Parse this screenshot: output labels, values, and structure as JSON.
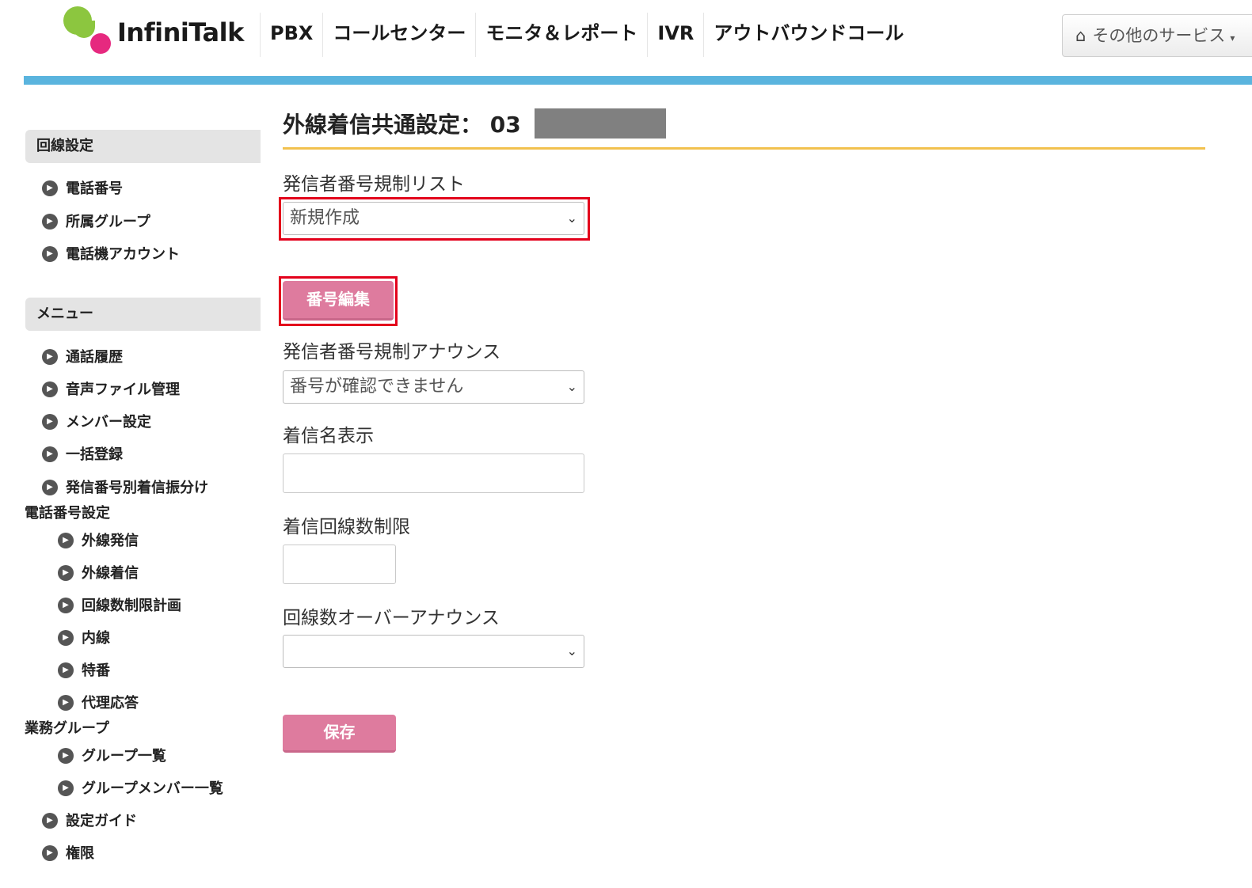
{
  "brand": {
    "name": "InfiniTalk",
    "colors": {
      "green": "#8cc63f",
      "pink": "#e6297f",
      "accent_bar": "#5ab4de",
      "button": "#de7b9e",
      "highlight": "#e3001b"
    }
  },
  "nav": {
    "items": [
      "PBX",
      "コールセンター",
      "モニタ＆レポート",
      "IVR",
      "アウトバウンドコール"
    ],
    "other_services": {
      "icon": "home-icon",
      "label": "その他のサービス"
    }
  },
  "sidebar": {
    "line_settings": {
      "heading": "回線設定",
      "items": [
        "電話番号",
        "所属グループ",
        "電話機アカウント"
      ]
    },
    "menu": {
      "heading": "メニュー",
      "items": [
        "通話履歴",
        "音声ファイル管理",
        "メンバー設定",
        "一括登録",
        "発信番号別着信振分け"
      ],
      "phone_settings": {
        "label": "電話番号設定",
        "items": [
          "外線発信",
          "外線着信",
          "回線数制限計画",
          "内線",
          "特番",
          "代理応答"
        ]
      },
      "business_group": {
        "label": "業務グループ",
        "items": [
          "グループ一覧",
          "グループメンバー一覧"
        ]
      },
      "bottom_items": [
        "設定ガイド",
        "権限"
      ]
    }
  },
  "main": {
    "title": "外線着信共通設定：",
    "title_number": "03",
    "fields": {
      "caller_restriction_list": {
        "label": "発信者番号規制リスト",
        "value": "新規作成"
      },
      "edit_number_button": "番号編集",
      "caller_restriction_announce": {
        "label": "発信者番号規制アナウンス",
        "value": "番号が確認できません"
      },
      "incoming_name_display": {
        "label": "着信名表示",
        "value": ""
      },
      "incoming_line_limit": {
        "label": "着信回線数制限",
        "value": ""
      },
      "line_over_announce": {
        "label": "回線数オーバーアナウンス",
        "value": ""
      }
    },
    "save_button": "保存"
  }
}
